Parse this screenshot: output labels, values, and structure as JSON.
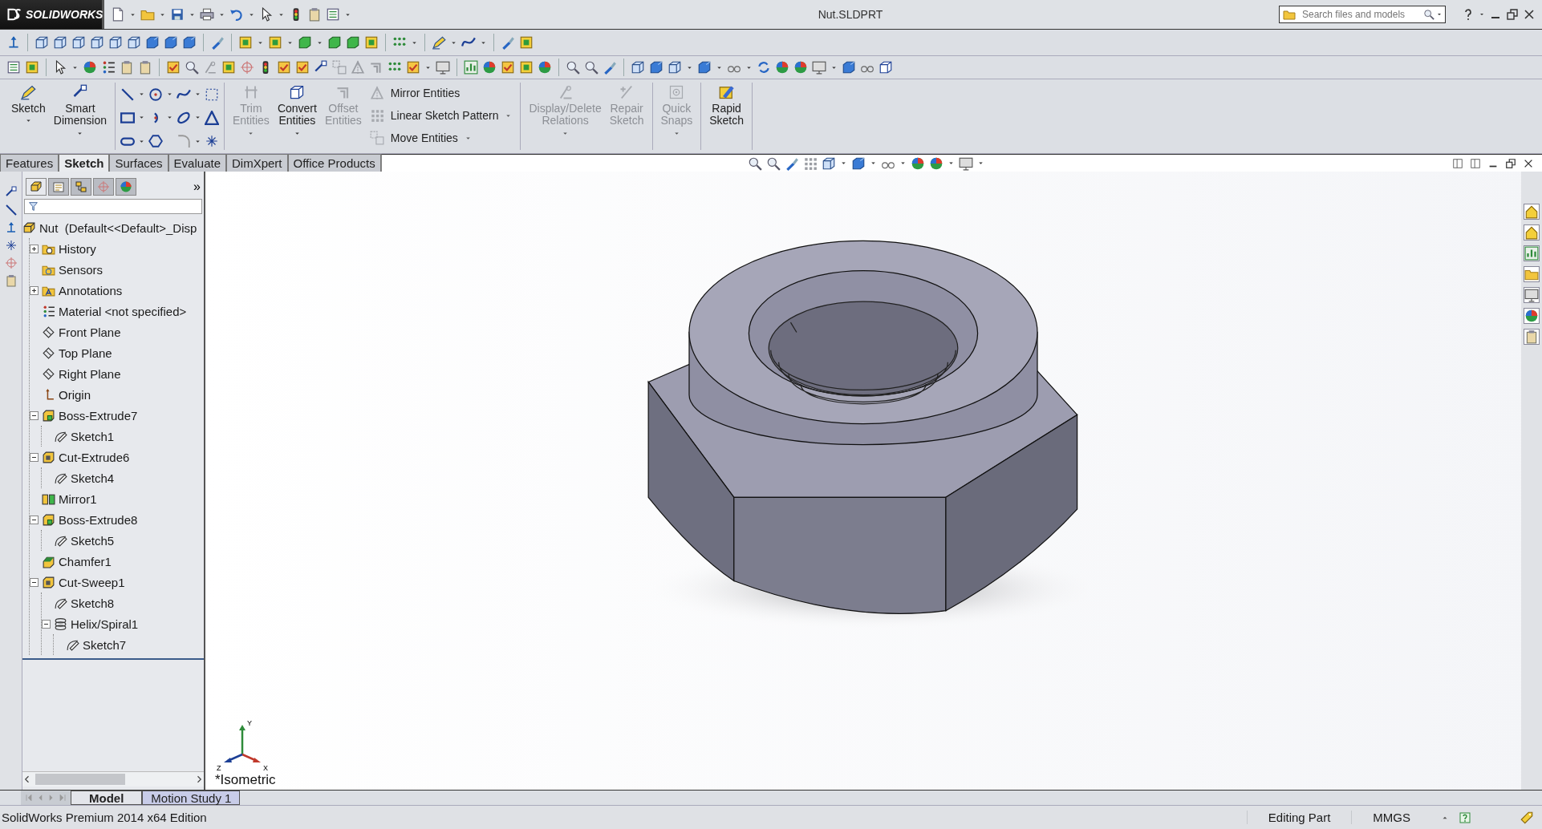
{
  "title_bar": {
    "logo": "SOLIDWORKS",
    "document": "Nut.SLDPRT",
    "search": {
      "placeholder": "Search files and models"
    }
  },
  "ribbon": {
    "groups": [
      {
        "kind": "buttons",
        "items": [
          {
            "label": "Sketch",
            "kind": "large",
            "disabled": false,
            "dropdown": true
          },
          {
            "label": "Smart Dimension",
            "kind": "large",
            "disabled": false,
            "dropdown": true
          }
        ]
      },
      {
        "kind": "tools"
      },
      {
        "kind": "buttons",
        "items": [
          {
            "label": "Trim Entities",
            "kind": "large",
            "disabled": true,
            "dropdown": true
          },
          {
            "label": "Convert Entities",
            "kind": "large",
            "disabled": false,
            "dropdown": true
          },
          {
            "label": "Offset Entities",
            "kind": "large",
            "disabled": true,
            "dropdown": false
          },
          {
            "label": "Mirror Entities",
            "kind": "small",
            "disabled": true,
            "dropdown": false
          },
          {
            "label": "Linear Sketch Pattern",
            "kind": "small",
            "disabled": true,
            "dropdown": true
          },
          {
            "label": "Move Entities",
            "kind": "small",
            "disabled": true,
            "dropdown": true
          }
        ]
      },
      {
        "kind": "buttons",
        "items": [
          {
            "label": "Display/Delete Relations",
            "kind": "large",
            "disabled": true,
            "dropdown": true
          },
          {
            "label": "Repair Sketch",
            "kind": "large",
            "disabled": true,
            "dropdown": false
          }
        ]
      },
      {
        "kind": "buttons",
        "items": [
          {
            "label": "Quick Snaps",
            "kind": "large",
            "disabled": true,
            "dropdown": true
          }
        ]
      },
      {
        "kind": "buttons",
        "items": [
          {
            "label": "Rapid Sketch",
            "kind": "large",
            "disabled": false,
            "dropdown": false
          }
        ]
      }
    ]
  },
  "tabs": [
    {
      "label": "Features",
      "selected": false
    },
    {
      "label": "Sketch",
      "selected": true
    },
    {
      "label": "Surfaces",
      "selected": false
    },
    {
      "label": "Evaluate",
      "selected": false
    },
    {
      "label": "DimXpert",
      "selected": false
    },
    {
      "label": "Office Products",
      "selected": false
    }
  ],
  "panel_tabs": [
    {
      "selected": true
    },
    {
      "selected": false
    },
    {
      "selected": false
    },
    {
      "selected": false
    },
    {
      "selected": false
    }
  ],
  "panel_expand": "»",
  "tree": {
    "root": {
      "label": "Nut  (Default<<Default>_Disp",
      "kind": "part"
    },
    "items": [
      {
        "label": "History",
        "kind": "history",
        "expanded": false
      },
      {
        "label": "Sensors",
        "kind": "sensors"
      },
      {
        "label": "Annotations",
        "kind": "annotations",
        "expanded": false
      },
      {
        "label": "Material <not specified>",
        "kind": "material"
      },
      {
        "label": "Front Plane",
        "kind": "plane"
      },
      {
        "label": "Top Plane",
        "kind": "plane"
      },
      {
        "label": "Right Plane",
        "kind": "plane"
      },
      {
        "label": "Origin",
        "kind": "origin"
      },
      {
        "label": "Boss-Extrude7",
        "kind": "boss",
        "expanded": true,
        "children": [
          {
            "label": "Sketch1",
            "kind": "sketch"
          }
        ]
      },
      {
        "label": "Cut-Extrude6",
        "kind": "cut",
        "expanded": true,
        "children": [
          {
            "label": "Sketch4",
            "kind": "sketch"
          }
        ]
      },
      {
        "label": "Mirror1",
        "kind": "mirror"
      },
      {
        "label": "Boss-Extrude8",
        "kind": "boss",
        "expanded": true,
        "children": [
          {
            "label": "Sketch5",
            "kind": "sketch"
          }
        ]
      },
      {
        "label": "Chamfer1",
        "kind": "chamfer"
      },
      {
        "label": "Cut-Sweep1",
        "kind": "cut",
        "expanded": true,
        "children": [
          {
            "label": "Sketch8",
            "kind": "sketch"
          },
          {
            "label": "Helix/Spiral1",
            "kind": "helix",
            "expanded": true,
            "children": [
              {
                "label": "Sketch7",
                "kind": "sketch"
              }
            ]
          }
        ]
      }
    ]
  },
  "viewport": {
    "view_name": "*Isometric",
    "triad": {
      "x": "X",
      "y": "Y",
      "z": "Z"
    }
  },
  "bottom_tabs": [
    {
      "label": "Model",
      "selected": true
    },
    {
      "label": "Motion Study 1",
      "selected": false
    }
  ],
  "status_bar": {
    "product": "SolidWorks Premium 2014 x64 Edition",
    "mode": "Editing Part",
    "units": "MMGS"
  }
}
